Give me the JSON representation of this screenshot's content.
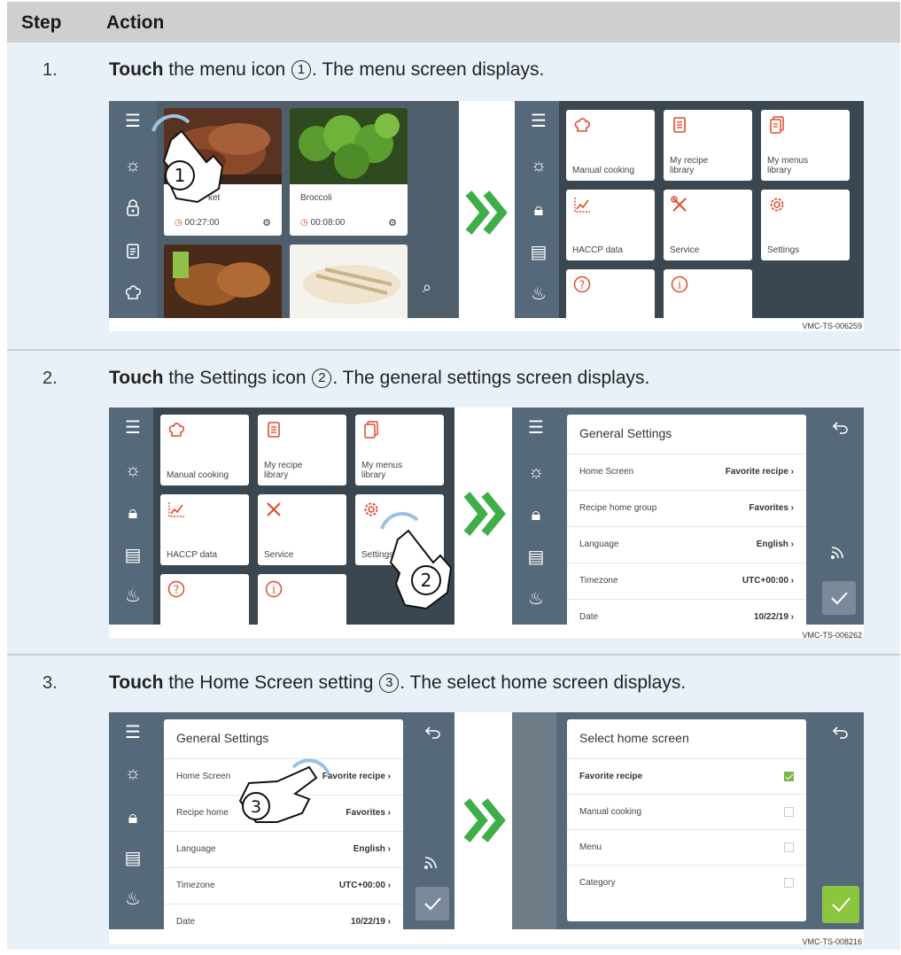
{
  "table": {
    "header_step": "Step",
    "header_action": "Action"
  },
  "steps": [
    {
      "number": "1.",
      "verb": "Touch",
      "text_a": " the menu icon ",
      "marker": "1",
      "text_b": ". The menu screen displays.",
      "figure_code": "VMC-TS-006259"
    },
    {
      "number": "2.",
      "verb": "Touch",
      "text_a": " the Settings icon ",
      "marker": "2",
      "text_b": ". The general settings screen displays.",
      "figure_code": "VMC-TS-006262"
    },
    {
      "number": "3.",
      "verb": "Touch",
      "text_a": " the Home Screen setting ",
      "marker": "3",
      "text_b": ". The select home screen displays.",
      "figure_code": "VMC-TS-008216"
    }
  ],
  "home_screen": {
    "recipes": [
      {
        "name": "Brisket",
        "visible_name": "ket",
        "time": "00:27:00"
      },
      {
        "name": "Broccoli",
        "visible_name": "Broccoli",
        "time": "00:08:00"
      }
    ]
  },
  "menu_screen": {
    "tiles": [
      {
        "label": "Manual cooking",
        "icon": "chef-hat-icon"
      },
      {
        "label": "My recipe library",
        "icon": "recipe-book-icon"
      },
      {
        "label": "My menus library",
        "icon": "menus-book-icon"
      },
      {
        "label": "HACCP data",
        "icon": "chart-icon"
      },
      {
        "label": "Service",
        "icon": "tools-icon"
      },
      {
        "label": "Settings",
        "icon": "gear-icon"
      },
      {
        "label": "",
        "icon": "help-icon"
      },
      {
        "label": "",
        "icon": "info-icon"
      }
    ]
  },
  "general_settings": {
    "title": "General Settings",
    "rows": [
      {
        "label": "Home Screen",
        "value": "Favorite recipe"
      },
      {
        "label": "Recipe home group",
        "value": "Favorites"
      },
      {
        "label": "Language",
        "value": "English"
      },
      {
        "label": "Timezone",
        "value": "UTC+00:00"
      },
      {
        "label": "Date",
        "value": "10/22/19"
      }
    ],
    "visible_label_row2_step3": "Recipe home"
  },
  "select_home": {
    "title": "Select home screen",
    "options": [
      {
        "label": "Favorite recipe",
        "selected": true
      },
      {
        "label": "Manual cooking",
        "selected": false
      },
      {
        "label": "Menu",
        "selected": false
      },
      {
        "label": "Category",
        "selected": false
      }
    ]
  },
  "colors": {
    "accent_red": "#e04a2f",
    "accent_green": "#8cc63f",
    "screen_dark": "#3a4650",
    "rail": "#56697a",
    "highlight_blue": "#e8f1f8"
  }
}
